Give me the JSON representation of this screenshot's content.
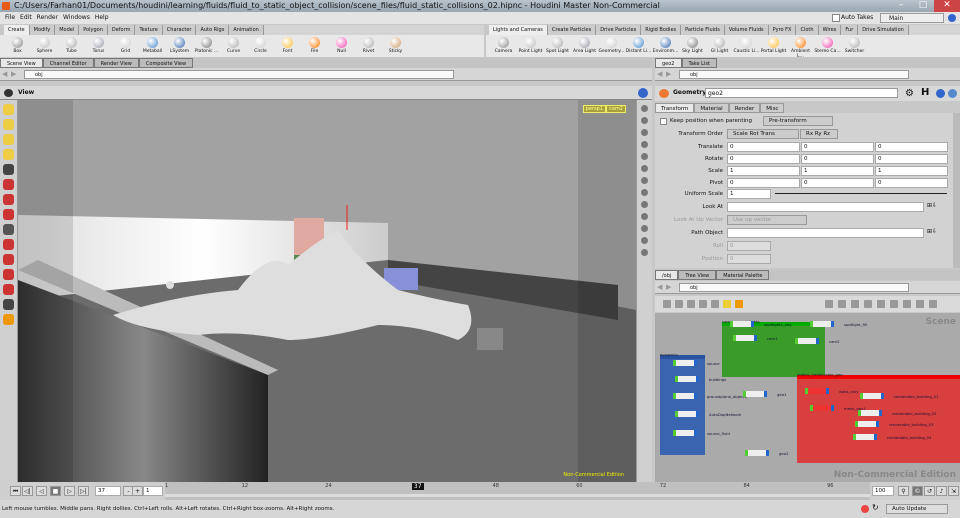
{
  "window": {
    "title": "C:/Users/Farhan01/Documents/houdini/learning/fluids/fluid_to_static_object_collision/scene_files/fluid_static_collisions_02.hipnc - Houdini Master Non-Commercial"
  },
  "menu": [
    "File",
    "Edit",
    "Render",
    "Windows",
    "Help"
  ],
  "auto_takes": "Auto Takes",
  "desktop": "Main",
  "shelf_left": {
    "tabs": [
      "Create",
      "Modify",
      "Model",
      "Polygon",
      "Deform",
      "Texture",
      "Character",
      "Auto Rigs",
      "Animation"
    ],
    "tools": [
      "Box",
      "Sphere",
      "Tube",
      "Torus",
      "Grid",
      "Metaball",
      "LSystem",
      "Platonic ...",
      "Curve",
      "Circle",
      "Font",
      "File",
      "Null",
      "Rivet",
      "Sticky"
    ]
  },
  "shelf_right": {
    "tabs": [
      "Lights and Cameras",
      "Create Particles",
      "Drive Particles",
      "Rigid Bodies",
      "Particle Fluids",
      "Volume Fluids",
      "Pyro FX",
      "Cloth",
      "Wires",
      "Fur",
      "Drive Simulation"
    ],
    "tools": [
      "Camera",
      "Point Light",
      "Spot Light",
      "Area Light",
      "Geometry...",
      "Distant Li...",
      "Environm...",
      "Sky Light",
      "GI Light",
      "Caustic Li...",
      "Portal Light",
      "Ambient L...",
      "Stereo Ca...",
      "Switcher"
    ]
  },
  "left_pane": {
    "tabs": [
      "Scene View",
      "Channel Editor",
      "Render View",
      "Composite View"
    ],
    "path": "obj",
    "view_label": "View",
    "cameras": [
      "persp1",
      "cam2"
    ],
    "watermark": "Non-Commercial Edition"
  },
  "parm_pane": {
    "tabs": [
      "geo2",
      "Take List"
    ],
    "path": "obj",
    "node_type": "Geometry",
    "node_name": "geo2",
    "ptabs": [
      "Transform",
      "Material",
      "Render",
      "Misc"
    ],
    "keep_pos": "Keep position when parenting",
    "pre_transform": "Pre-transform",
    "transform_order_label": "Transform Order",
    "transform_order": "Scale Rot Trans",
    "rot_order": "Rx Ry Rz",
    "translate": {
      "label": "Translate",
      "v": [
        "0",
        "0",
        "0"
      ]
    },
    "rotate": {
      "label": "Rotate",
      "v": [
        "0",
        "0",
        "0"
      ]
    },
    "scale": {
      "label": "Scale",
      "v": [
        "1",
        "1",
        "1"
      ]
    },
    "pivot": {
      "label": "Pivot",
      "v": [
        "0",
        "0",
        "0"
      ]
    },
    "uniform_scale": {
      "label": "Uniform Scale",
      "v": "1"
    },
    "look_at": "Look At",
    "look_up": "Look At Up Vector",
    "look_up_val": "Use up vector",
    "path_object": "Path Object",
    "roll": "Roll",
    "roll_val": "0",
    "position": "Position",
    "position_val": "0"
  },
  "net_pane": {
    "tabs": [
      "/obj",
      "Tree View",
      "Material Palette"
    ],
    "path": "obj",
    "scene_label": "Scene",
    "watermark": "Non-Commercial Edition",
    "boxes": [
      {
        "name": "cameras_and_lights",
        "color": "#3a9a2a"
      },
      {
        "name": "dynamics",
        "color": "#3a64b0"
      },
      {
        "name": "statics_(renderable_geo",
        "color": "#d84040"
      }
    ],
    "nodes": [
      "spotlight1_key",
      "spotlight_fill",
      "cam1",
      "cam2",
      "source",
      "buildings",
      "groundplane_object1",
      "AutoDopNetwork",
      "source_fluid",
      "geo1",
      "walls_only",
      "mesh_geo1",
      "renderable_building_01",
      "renderable_building_02",
      "renderable_building_03",
      "renderable_building_04",
      "geo2"
    ]
  },
  "timeline": {
    "current_frame": "37",
    "step": "1",
    "start": 1,
    "end": 100,
    "end_label": "100",
    "ticks": [
      "1",
      "12",
      "24",
      "37",
      "48",
      "60",
      "72",
      "84",
      "96"
    ]
  },
  "status": {
    "message": "Left mouse tumbles. Middle pans. Right dollies. Ctrl+Left rolls. Alt+Left rotates. Ctrl+Right box-zooms. Alt+Right zooms.",
    "update_mode": "Auto Update"
  }
}
